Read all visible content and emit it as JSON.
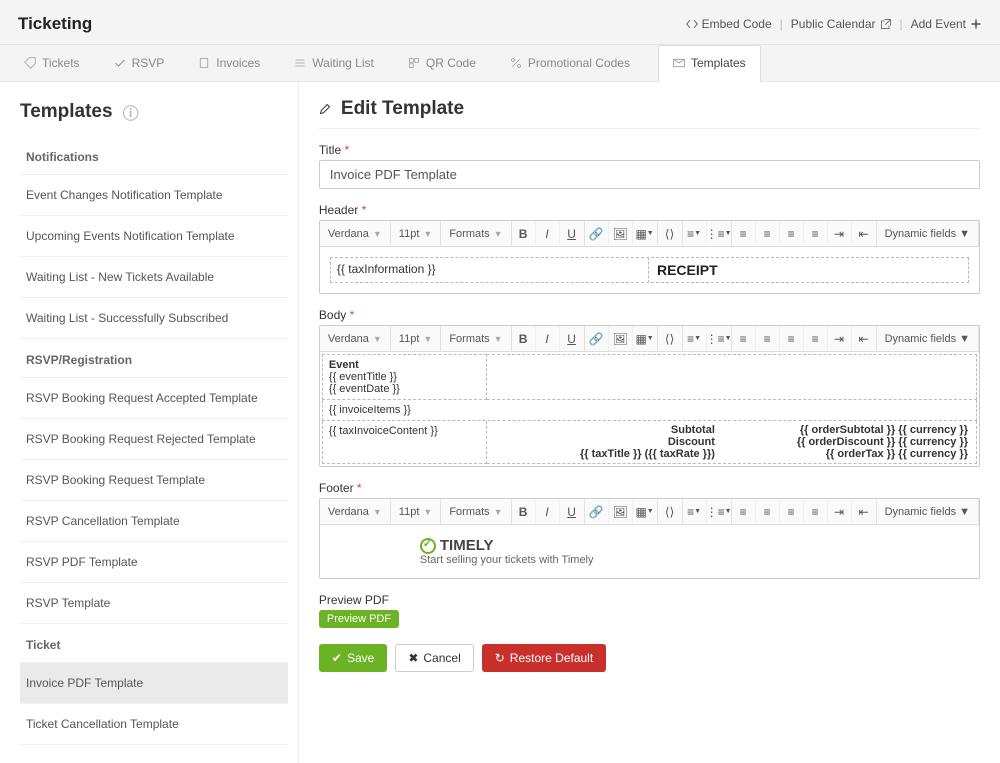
{
  "page_title": "Ticketing",
  "top_actions": {
    "embed": "Embed Code",
    "calendar": "Public Calendar",
    "add_event": "Add Event"
  },
  "tabs": {
    "tickets": "Tickets",
    "rsvp": "RSVP",
    "invoices": "Invoices",
    "waiting": "Waiting List",
    "qr": "QR Code",
    "promo": "Promotional Codes",
    "templates": "Templates"
  },
  "left": {
    "title": "Templates",
    "groups": [
      {
        "header": "Notifications",
        "items": [
          "Event Changes Notification Template",
          "Upcoming Events Notification Template",
          "Waiting List - New Tickets Available",
          "Waiting List - Successfully Subscribed"
        ]
      },
      {
        "header": "RSVP/Registration",
        "items": [
          "RSVP Booking Request Accepted Template",
          "RSVP Booking Request Rejected Template",
          "RSVP Booking Request Template",
          "RSVP Cancellation Template",
          "RSVP PDF Template",
          "RSVP Template"
        ]
      },
      {
        "header": "Ticket",
        "items": [
          "Invoice PDF Template",
          "Ticket Cancellation Template"
        ],
        "selected": 0
      }
    ]
  },
  "right": {
    "title": "Edit Template",
    "title_label": "Title",
    "title_val": "Invoice PDF Template",
    "header_label": "Header",
    "body_label": "Body",
    "footer_label": "Footer",
    "preview_label": "Preview PDF",
    "preview_btn": "Preview PDF",
    "save": "Save",
    "cancel": "Cancel",
    "restore": "Restore Default",
    "toolbar": {
      "font": "Verdana",
      "size": "11pt",
      "formats": "Formats",
      "dynamic": "Dynamic fields"
    },
    "header_content": {
      "tax": "{{ taxInformation }}",
      "receipt": "RECEIPT"
    },
    "body_content": {
      "event_lbl": "Event",
      "event_title": "{{ eventTitle }}",
      "event_date": "{{ eventDate }}",
      "invoice_items": "{{ invoiceItems }}",
      "tax_invoice": "{{ taxInvoiceContent }}",
      "subtotal_lbl": "Subtotal",
      "subtotal_val": "{{ orderSubtotal }} {{ currency }}",
      "discount_lbl": "Discount",
      "discount_val": "{{ orderDiscount }} {{ currency }}",
      "taxrow_lbl": "{{ taxTitle }} ({{ taxRate }})",
      "taxrow_val": "{{ orderTax }} {{ currency }}"
    },
    "footer_content": {
      "brand": "TIMELY",
      "tagline": "Start selling your tickets with Timely"
    }
  }
}
